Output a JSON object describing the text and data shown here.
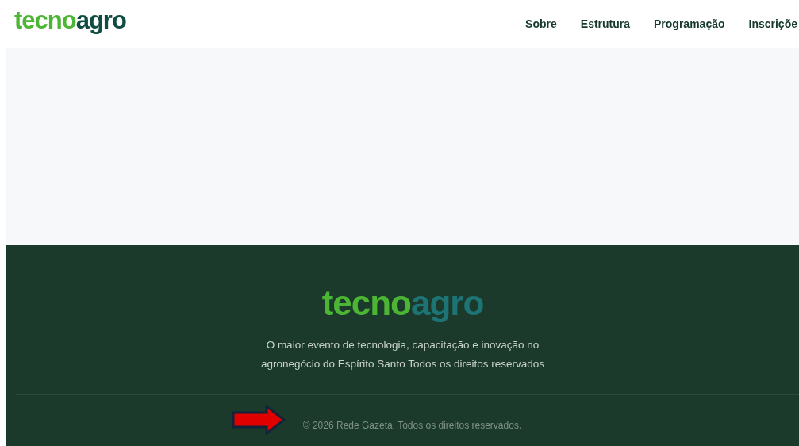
{
  "header": {
    "logo": {
      "left": "tecno",
      "right": "agro"
    },
    "nav": [
      {
        "label": "Sobre"
      },
      {
        "label": "Estrutura"
      },
      {
        "label": "Programação"
      },
      {
        "label": "Inscriçõe"
      }
    ]
  },
  "footer": {
    "logo": {
      "left": "tecno",
      "right": "agro"
    },
    "tagline": "O maior evento de tecnologia, capacitação e inovação no agronegócio do Espírito Santo Todos os direitos reservados",
    "copyright": "© 2026 Rede Gazeta. Todos os direitos reservados."
  }
}
